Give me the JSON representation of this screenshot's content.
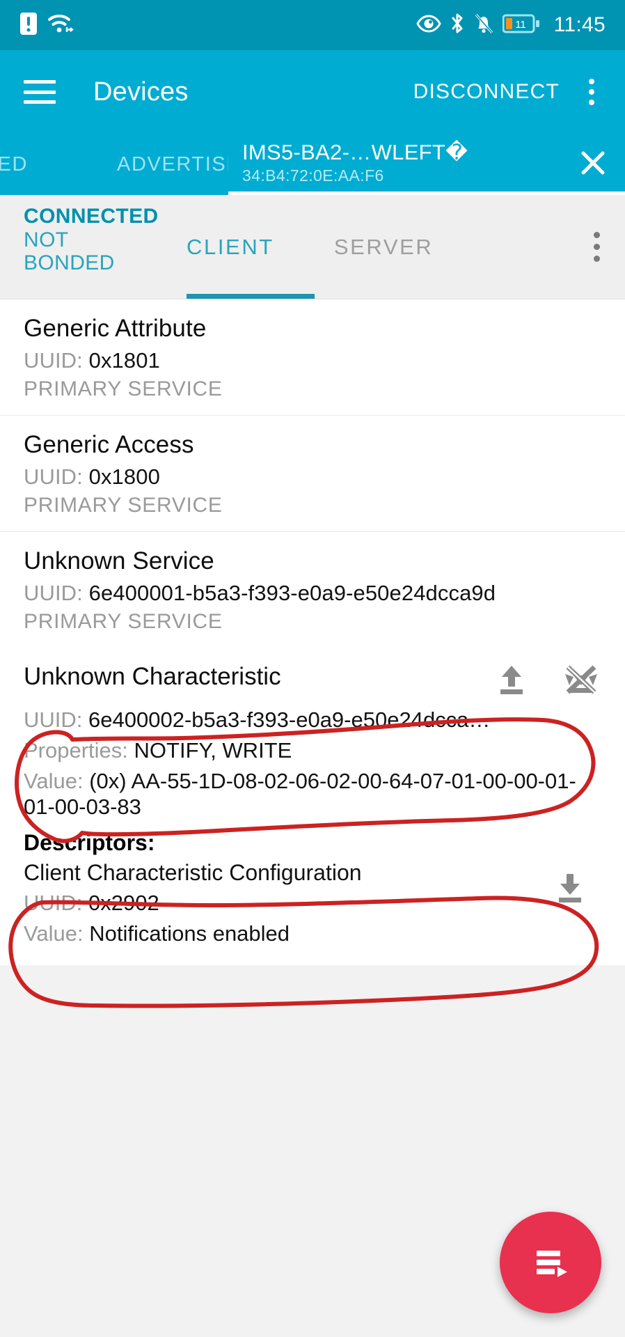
{
  "status_bar": {
    "time": "11:45",
    "battery_level": "11",
    "left_icons": [
      "sim-alert-icon",
      "wifi-icon"
    ],
    "right_icons": [
      "eye-icon",
      "bluetooth-icon",
      "bell-muted-icon",
      "battery-icon"
    ],
    "background": "#0093b2"
  },
  "app_bar": {
    "title": "Devices",
    "action_label": "DISCONNECT",
    "menu_icon": "kebab-menu-icon",
    "nav_icon": "hamburger-icon",
    "background": "#00acd1"
  },
  "device_tabs": {
    "partial_tab_label": "DED",
    "advertiser_tab_label": "ADVERTISER",
    "active_tab": {
      "name": "IMS5-BA2-…WLEFT�",
      "address": "34:B4:72:0E:AA:F6",
      "close_icon": "close-icon"
    }
  },
  "connection": {
    "state_line1": "CONNECTED",
    "state_line2": "NOT",
    "state_line3": "BONDED",
    "tabs": [
      {
        "label": "CLIENT",
        "selected": true
      },
      {
        "label": "SERVER",
        "selected": false
      }
    ],
    "overflow_icon": "kebab-menu-icon",
    "accent": "#1b95b0"
  },
  "services": [
    {
      "name": "Generic Attribute",
      "uuid_label": "UUID:",
      "uuid": "0x1801",
      "type": "PRIMARY SERVICE"
    },
    {
      "name": "Generic Access",
      "uuid_label": "UUID:",
      "uuid": "0x1800",
      "type": "PRIMARY SERVICE"
    },
    {
      "name": "Unknown Service",
      "uuid_label": "UUID:",
      "uuid": "6e400001-b5a3-f393-e0a9-e50e24dcca9d",
      "type": "PRIMARY SERVICE"
    }
  ],
  "characteristic": {
    "name": "Unknown Characteristic",
    "uuid_label": "UUID:",
    "uuid": "6e400002-b5a3-f393-e0a9-e50e24dcca…",
    "properties_label": "Properties:",
    "properties": "NOTIFY, WRITE",
    "value_label": "Value:",
    "value": "(0x) AA-55-1D-08-02-06-02-00-64-07-01-00-00-01-01-00-03-83",
    "write_icon": "upload-arrow-icon",
    "notify_off_icon": "notifications-disabled-icon",
    "descriptors_label": "Descriptors:",
    "descriptor": {
      "name": "Client Characteristic Configuration",
      "uuid_label": "UUID:",
      "uuid": "0x2902",
      "value_label": "Value:",
      "value": "Notifications enabled",
      "read_icon": "download-arrow-icon"
    }
  },
  "fab": {
    "icon": "run-script-icon",
    "color": "#e8304f"
  },
  "annotations": {
    "color": "#cc2222",
    "shapes": [
      "ellipse-around-characteristic-header",
      "ellipse-around-descriptors"
    ]
  }
}
